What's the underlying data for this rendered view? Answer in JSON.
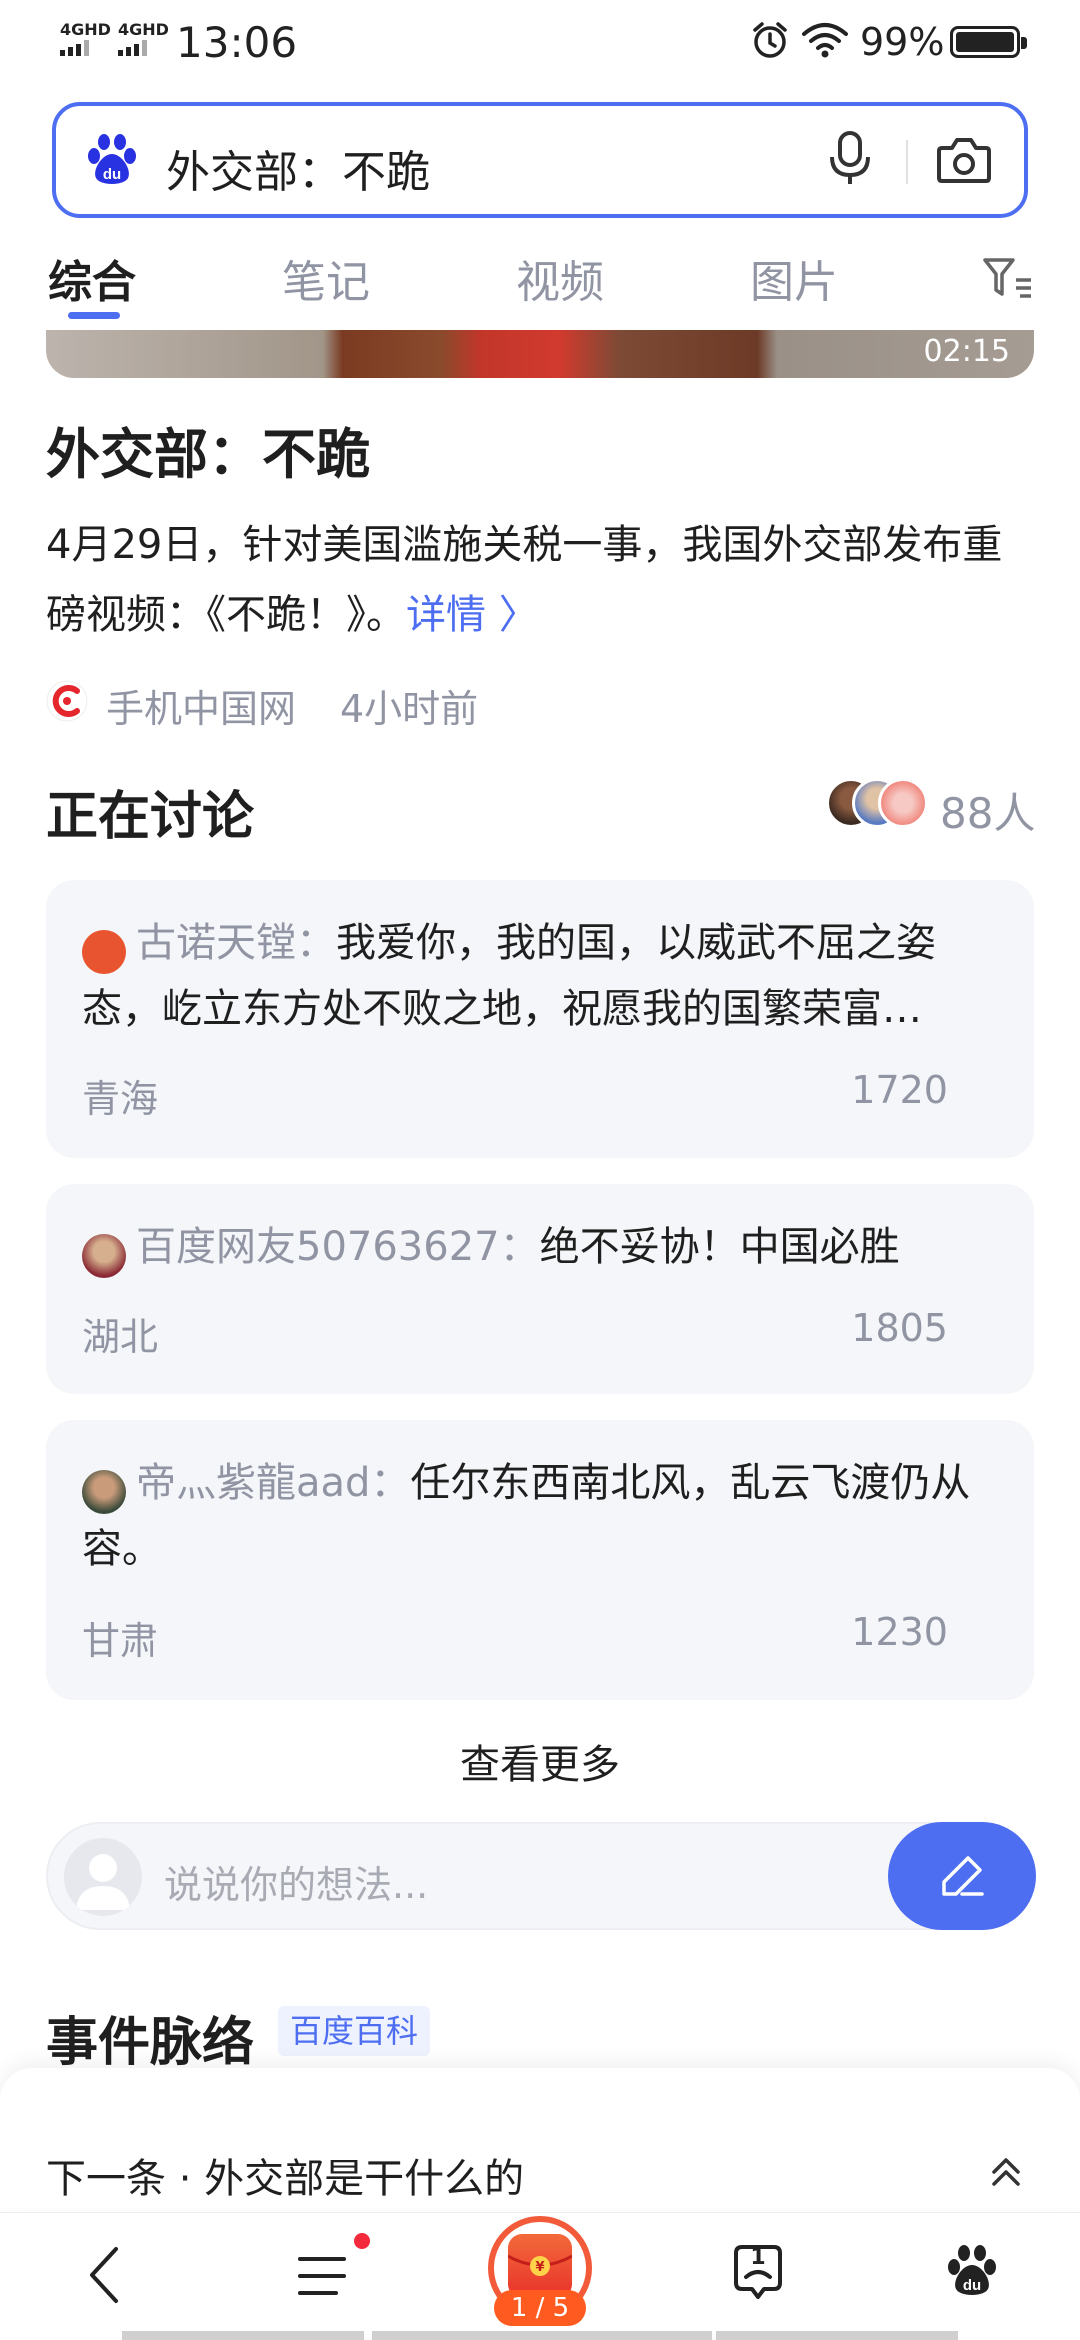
{
  "status_bar": {
    "network_1": "4GHD",
    "network_2": "4GHD",
    "time": "13:06",
    "battery": "99%"
  },
  "search": {
    "query": "外交部：不跪"
  },
  "tabs": [
    {
      "label": "综合",
      "active": true
    },
    {
      "label": "笔记",
      "active": false
    },
    {
      "label": "视频",
      "active": false
    },
    {
      "label": "图片",
      "active": false
    }
  ],
  "video": {
    "duration": "02:15"
  },
  "article": {
    "title": "外交部：不跪",
    "description": "4月29日，针对美国滥施关税一事，我国外交部发布重磅视频：《不跪！》。",
    "detail_link": "详情 〉",
    "source": "手机中国网",
    "time": "4小时前"
  },
  "discussion": {
    "title": "正在讨论",
    "count": "88人",
    "comments": [
      {
        "user": "古诺天镗：",
        "text": "我爱你，我的国，以威武不屈之姿态，屹立东方处不败之地，祝愿我的国繁荣富…",
        "region": "青海",
        "likes": "1720"
      },
      {
        "user": "百度网友50763627：",
        "text": "绝不妥协！中国必胜",
        "region": "湖北",
        "likes": "1805"
      },
      {
        "user": "帝灬紫龍aad：",
        "text": "任尔东西南北风，乱云飞渡仍从容。",
        "region": "甘肃",
        "likes": "1230"
      }
    ],
    "see_more": "查看更多",
    "input_placeholder": "说说你的想法..."
  },
  "events": {
    "title": "事件脉络",
    "badge": "百度百科"
  },
  "next": {
    "label": "下一条 · 外交部是干什么的"
  },
  "bottom_nav": {
    "page_indicator": "1 / 5",
    "tab_count": "1"
  },
  "colors": {
    "accent": "#4e6ef2",
    "secondary_text": "#9195a3",
    "card_bg": "#f5f6f9",
    "notification": "#f4293c"
  }
}
